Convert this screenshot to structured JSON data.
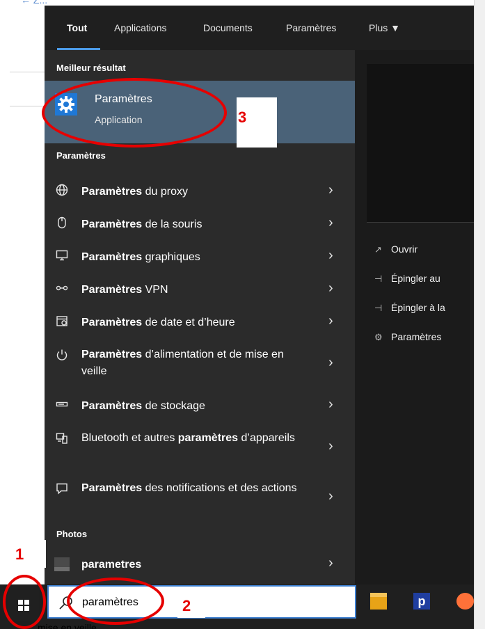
{
  "background": {
    "back_link": "← Z..."
  },
  "tabs": [
    {
      "label": "Tout"
    },
    {
      "label": "Applications"
    },
    {
      "label": "Documents"
    },
    {
      "label": "Paramètres"
    },
    {
      "label": "Plus ▼"
    }
  ],
  "best_match": {
    "section": "Meilleur résultat",
    "title": "Paramètres",
    "subtitle": "Application",
    "icon": "gear-icon"
  },
  "settings_section": "Paramètres",
  "settings_rows": [
    {
      "icon": "globe-icon",
      "bold": "Paramètres",
      "rest": " du proxy"
    },
    {
      "icon": "mouse-icon",
      "bold": "Paramètres",
      "rest": " de la souris"
    },
    {
      "icon": "monitor-icon",
      "bold": "Paramètres",
      "rest": " graphiques"
    },
    {
      "icon": "vpn-icon",
      "bold": "Paramètres",
      "rest": " VPN"
    },
    {
      "icon": "calendar-icon",
      "bold": "Paramètres",
      "rest": " de date et d’heure"
    },
    {
      "icon": "power-icon",
      "bold": "Paramètres",
      "rest": " d’alimentation et de mise en veille"
    },
    {
      "icon": "storage-icon",
      "bold": "Paramètres",
      "rest": " de stockage"
    },
    {
      "icon": "devices-icon",
      "pre": "Bluetooth et autres ",
      "bold": "paramètres",
      "rest": " d’appareils"
    },
    {
      "icon": "notification-icon",
      "bold": "Paramètres",
      "rest": " des notifications et des actions"
    }
  ],
  "photos_section": "Photos",
  "photos_row": {
    "label": "parametres",
    "icon": "photo-thumbnail-icon"
  },
  "actions": [
    {
      "icon": "open-icon",
      "label": "Ouvrir"
    },
    {
      "icon": "pin-icon",
      "label": "Épingler au"
    },
    {
      "icon": "pin-icon",
      "label": "Épingler à la"
    },
    {
      "icon": "gear-icon",
      "label": "Paramètres"
    }
  ],
  "search": {
    "value": "paramètres"
  },
  "taskbar_tail_text": "mise en veille",
  "annotations": {
    "n1": "1",
    "n2": "2",
    "n3": "3"
  },
  "colors": {
    "highlight": "#4a6278",
    "accent": "#4c9be8",
    "annotation": "#e60000",
    "panel": "#2b2b2b"
  }
}
